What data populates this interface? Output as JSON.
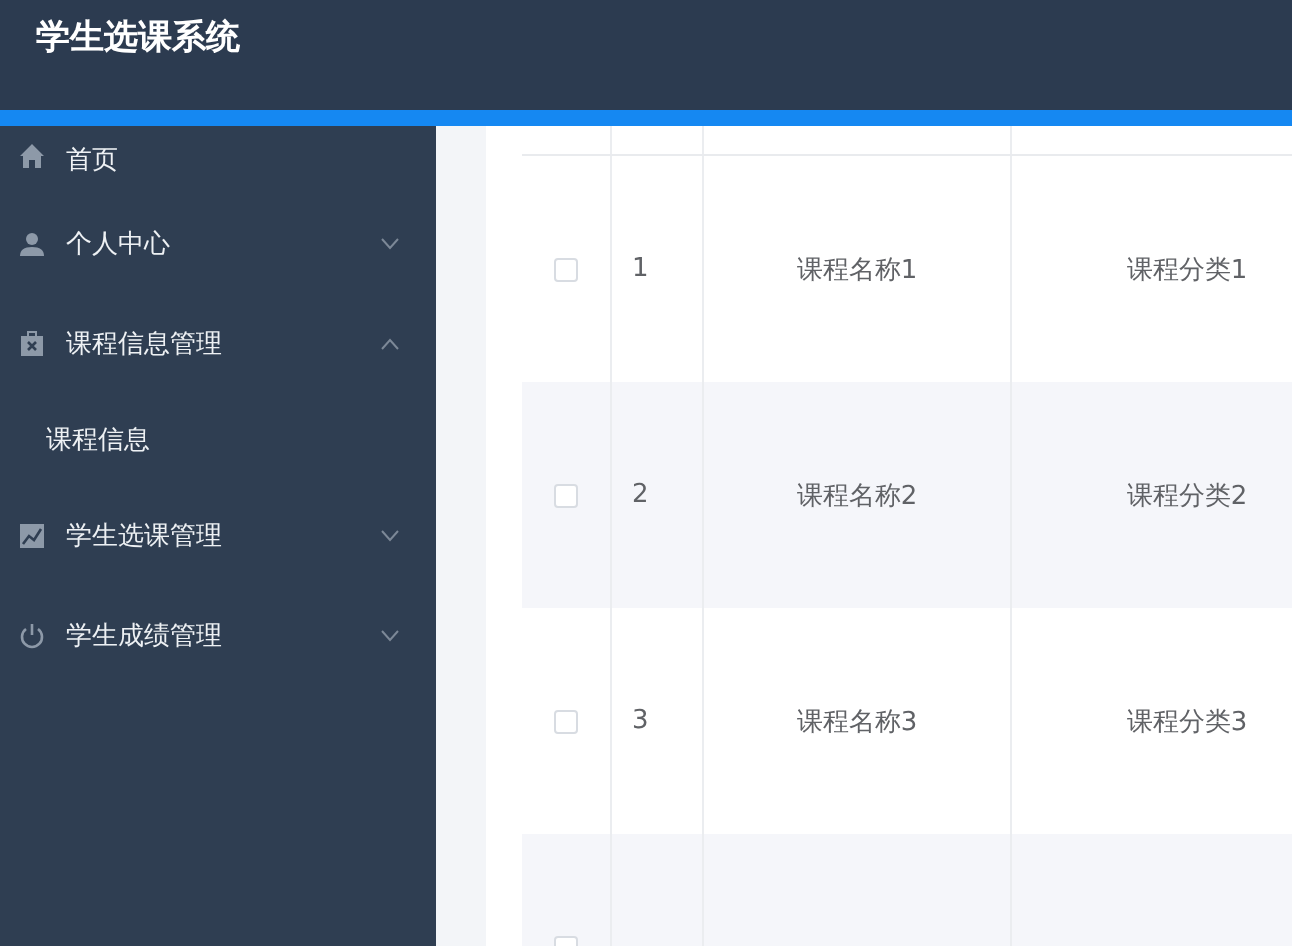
{
  "header": {
    "title": "学生选课系统"
  },
  "sidebar": {
    "items": [
      {
        "kind": "link",
        "label": "首页"
      },
      {
        "kind": "group",
        "label": "个人中心",
        "expanded": false
      },
      {
        "kind": "group",
        "label": "课程信息管理",
        "expanded": true,
        "children": [
          {
            "label": "课程信息"
          }
        ]
      },
      {
        "kind": "group",
        "label": "学生选课管理",
        "expanded": false
      },
      {
        "kind": "group",
        "label": "学生成绩管理",
        "expanded": false
      }
    ]
  },
  "table": {
    "rows": [
      {
        "checked": false,
        "index": "1",
        "name": "课程名称1",
        "category": "课程分类1"
      },
      {
        "checked": false,
        "index": "2",
        "name": "课程名称2",
        "category": "课程分类2"
      },
      {
        "checked": false,
        "index": "3",
        "name": "课程名称3",
        "category": "课程分类3"
      },
      {
        "checked": false
      }
    ]
  }
}
